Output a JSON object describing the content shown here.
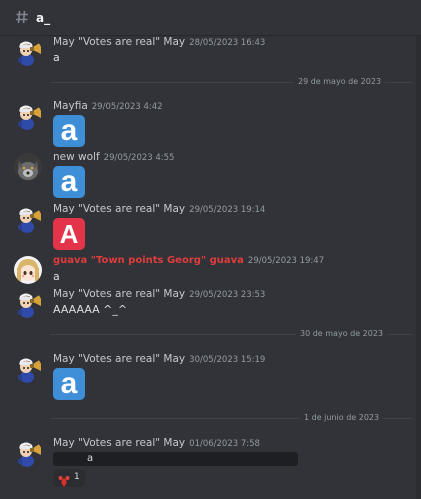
{
  "channel": {
    "name": "a_",
    "icon": "hash-icon"
  },
  "messages": [
    {
      "author": "May \"Votes are real\" May",
      "timestamp": "28/05/2023 16:43",
      "text": "a",
      "avatar": "mascot-avatar"
    },
    {
      "separator": "29 de mayo de 2023"
    },
    {
      "author": "Mayfia",
      "timestamp": "29/05/2023 4:42",
      "emoji": "a",
      "avatar": "mascot-avatar"
    },
    {
      "author": "new wolf",
      "timestamp": "29/05/2023 4:55",
      "emoji": "a",
      "avatar": "wolf-avatar"
    },
    {
      "author": "May \"Votes are real\" May",
      "timestamp": "29/05/2023 19:14",
      "emoji": "A",
      "avatar": "mascot-avatar"
    },
    {
      "author": "guava \"Town points Georg\" guava",
      "timestamp": "29/05/2023 19:47",
      "text": "a",
      "avatar": "anime-avatar",
      "color": "#e03c3c"
    },
    {
      "author": "May \"Votes are real\" May",
      "timestamp": "29/05/2023 23:53",
      "text": "AAAAAA ^_^",
      "avatar": "mascot-avatar"
    },
    {
      "separator": "30 de mayo de 2023"
    },
    {
      "author": "May \"Votes are real\" May",
      "timestamp": "30/05/2023 15:19",
      "emoji": "a",
      "avatar": "mascot-avatar"
    },
    {
      "separator": "1 de junio de 2023"
    },
    {
      "author": "May \"Votes are real\" May",
      "timestamp": "01/06/2023 7:58",
      "spoiler_visible": "a",
      "avatar": "mascot-avatar",
      "reaction": {
        "icon": "lobster-icon",
        "count": "1"
      }
    }
  ],
  "colors": {
    "background": "#313338",
    "emoji_blue": "#3e8fd8",
    "emoji_red": "#e3344a",
    "role_red": "#e03c3c"
  }
}
